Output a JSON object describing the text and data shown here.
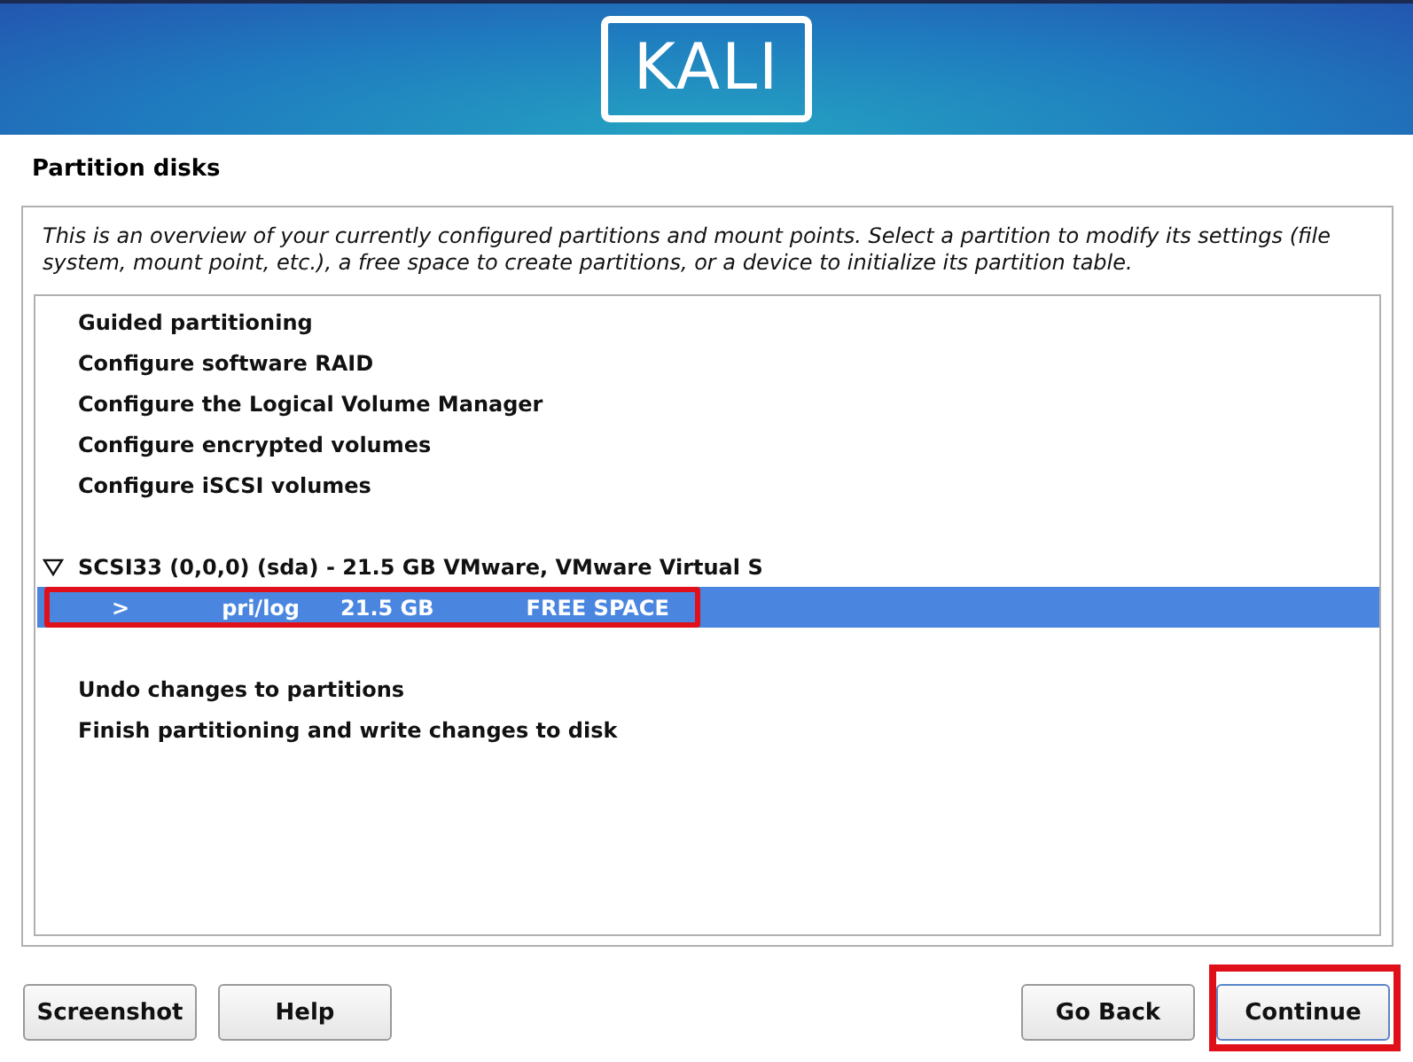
{
  "logo": "KALI",
  "title": "Partition disks",
  "description": "This is an overview of your currently configured partitions and mount points. Select a partition to modify its settings (file system, mount point, etc.), a free space to create partitions, or a device to initialize its partition table.",
  "sections": [
    [
      {
        "kind": "action",
        "label": "Guided partitioning",
        "selected": false
      },
      {
        "kind": "action",
        "label": "Configure software RAID",
        "selected": false
      },
      {
        "kind": "action",
        "label": "Configure the Logical Volume Manager",
        "selected": false
      },
      {
        "kind": "action",
        "label": "Configure encrypted volumes",
        "selected": false
      },
      {
        "kind": "action",
        "label": "Configure iSCSI volumes",
        "selected": false
      }
    ],
    [
      {
        "kind": "disk",
        "label": "SCSI33 (0,0,0) (sda) - 21.5 GB VMware, VMware Virtual S",
        "expanded": true,
        "selected": false
      },
      {
        "kind": "partition",
        "marker": ">",
        "type": "pri/log",
        "size": "21.5 GB",
        "usage": "FREE SPACE",
        "selected": true,
        "highlighted": true
      }
    ],
    [
      {
        "kind": "action",
        "label": "Undo changes to partitions",
        "selected": false
      },
      {
        "kind": "action",
        "label": "Finish partitioning and write changes to disk",
        "selected": false
      }
    ]
  ],
  "buttons_left": [
    {
      "label": "Screenshot",
      "focused": false,
      "highlighted": false
    },
    {
      "label": "Help",
      "focused": false,
      "highlighted": false
    }
  ],
  "buttons_right": [
    {
      "label": "Go Back",
      "focused": false,
      "highlighted": false
    },
    {
      "label": "Continue",
      "focused": true,
      "highlighted": true
    }
  ]
}
